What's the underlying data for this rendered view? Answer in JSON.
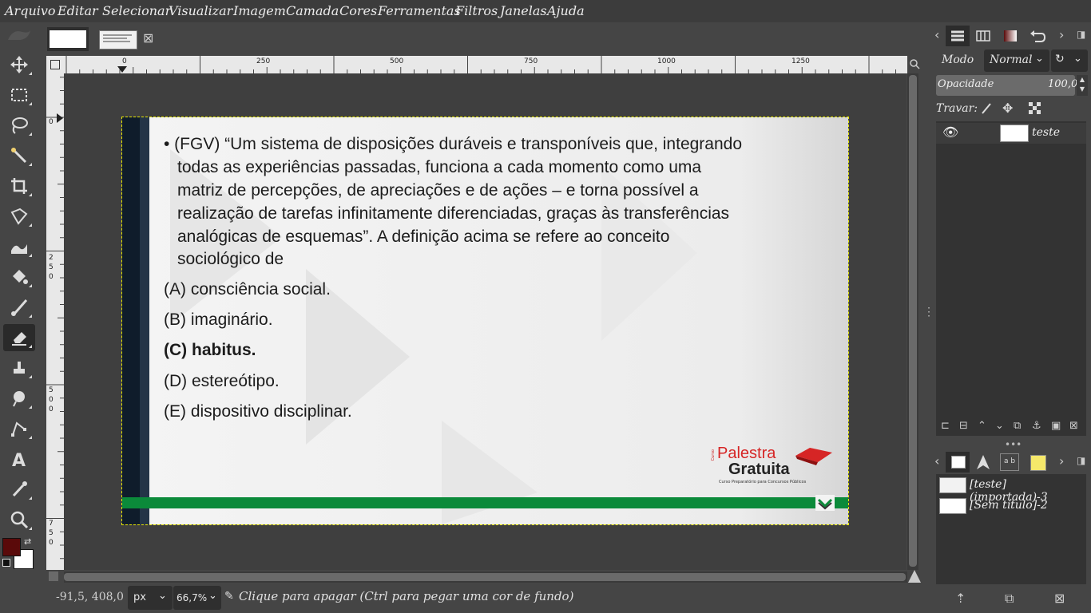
{
  "menu": [
    "Arquivo",
    "Editar",
    "Selecionar",
    "Visualizar",
    "Imagem",
    "Camada",
    "Cores",
    "Ferramentas",
    "Filtros",
    "Janelas",
    "Ajuda"
  ],
  "rulers": {
    "h_labels": [
      "0",
      "250",
      "500",
      "750",
      "1000",
      "1250"
    ],
    "v_labels": [
      [
        "0"
      ],
      [
        "2",
        "5",
        "0"
      ],
      [
        "5",
        "0",
        "0"
      ],
      [
        "7",
        "5",
        "0"
      ]
    ]
  },
  "slide": {
    "question_lines": [
      "• (FGV) “Um sistema de disposições duráveis e transponíveis que, integrando",
      "todas as experiências passadas, funciona a cada momento como uma",
      "matriz de percepções, de apreciações e de ações – e torna possível a",
      "realização de tarefas infinitamente diferenciadas, graças às transferências",
      "analógicas de esquemas”. A definição acima se refere ao conceito",
      "sociológico de"
    ],
    "options": [
      {
        "text": "(A) consciência social.",
        "bold": false
      },
      {
        "text": "(B) imaginário.",
        "bold": false
      },
      {
        "text": "(C) habitus.",
        "bold": true
      },
      {
        "text": "(D) estereótipo.",
        "bold": false
      },
      {
        "text": "(E) dispositivo disciplinar.",
        "bold": false
      }
    ],
    "logo": {
      "prefix": "Curso",
      "line1": "Palestra",
      "line2": "Gratuita",
      "tagline": "Curso Preparatório para Concursos Públicos"
    }
  },
  "layers_panel": {
    "mode_label": "Modo",
    "mode_value": "Normal",
    "opacity_label": "Opacidade",
    "opacity_value": "100,0",
    "lock_label": "Travar:",
    "layer_name": "teste"
  },
  "images_panel": {
    "items": [
      "[teste] (importada)-3",
      "[Sem título]-2"
    ]
  },
  "status": {
    "coords": "-91,5, 408,0",
    "unit": "px",
    "zoom": "66,7%",
    "message": "Clique para apagar (Ctrl para pegar uma cor de fundo)"
  },
  "colors": {
    "foreground": "#5a0a0a",
    "background": "#ffffff",
    "green_bar": "#0b8a3a",
    "logo_red": "#d62525"
  }
}
